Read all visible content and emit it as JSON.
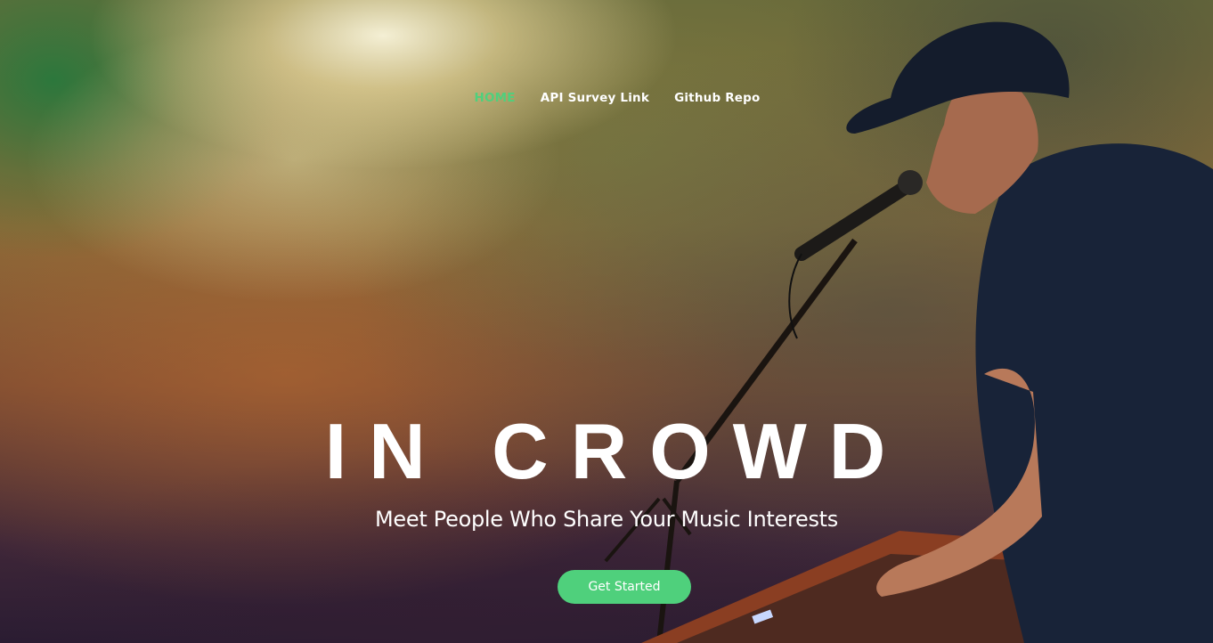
{
  "nav": {
    "items": [
      {
        "label": "HOME",
        "active": true
      },
      {
        "label": "API Survey Link",
        "active": false
      },
      {
        "label": "Github Repo",
        "active": false
      }
    ]
  },
  "hero": {
    "title": "IN CROWD",
    "subtitle": "Meet People Who Share Your Music Interests",
    "cta_label": "Get Started"
  },
  "colors": {
    "accent": "#4fd07c",
    "text": "#ffffff"
  },
  "background": {
    "subject": "performer-singing-at-microphone-with-keyboard"
  }
}
